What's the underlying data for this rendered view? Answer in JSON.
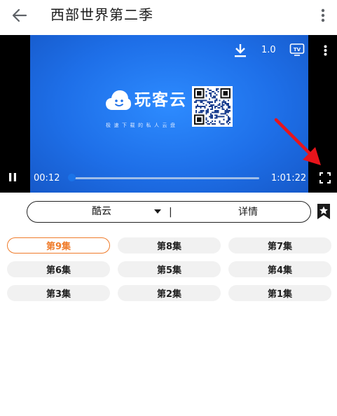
{
  "header": {
    "title": "西部世界第二季",
    "back_icon": "arrow-left-icon",
    "more_icon": "more-vertical-icon"
  },
  "player": {
    "logo_text": "玩客云",
    "logo_slogan": "极速下载的私人云盘",
    "speed": "1.0",
    "tv_label": "TV",
    "current_time": "00:12",
    "total_time": "1:01:22",
    "progress_fraction": 0.003,
    "icons": {
      "download": "download-icon",
      "cast": "tv-cast-icon",
      "more": "more-vertical-icon",
      "pause": "pause-icon",
      "fullscreen": "fullscreen-icon"
    },
    "colors": {
      "video_blue": "#1e6fe8",
      "annotation_arrow": "#e8141b"
    }
  },
  "source_bar": {
    "source": "酷云",
    "divider": "|",
    "details": "详情",
    "bookmark_icon": "bookmark-star-icon"
  },
  "episodes": [
    {
      "label": "第9集",
      "selected": true
    },
    {
      "label": "第8集",
      "selected": false
    },
    {
      "label": "第7集",
      "selected": false
    },
    {
      "label": "第6集",
      "selected": false
    },
    {
      "label": "第5集",
      "selected": false
    },
    {
      "label": "第4集",
      "selected": false
    },
    {
      "label": "第3集",
      "selected": false
    },
    {
      "label": "第2集",
      "selected": false
    },
    {
      "label": "第1集",
      "selected": false
    }
  ],
  "colors": {
    "accent": "#ef7b2a",
    "chip_background": "#f1f1f1"
  }
}
